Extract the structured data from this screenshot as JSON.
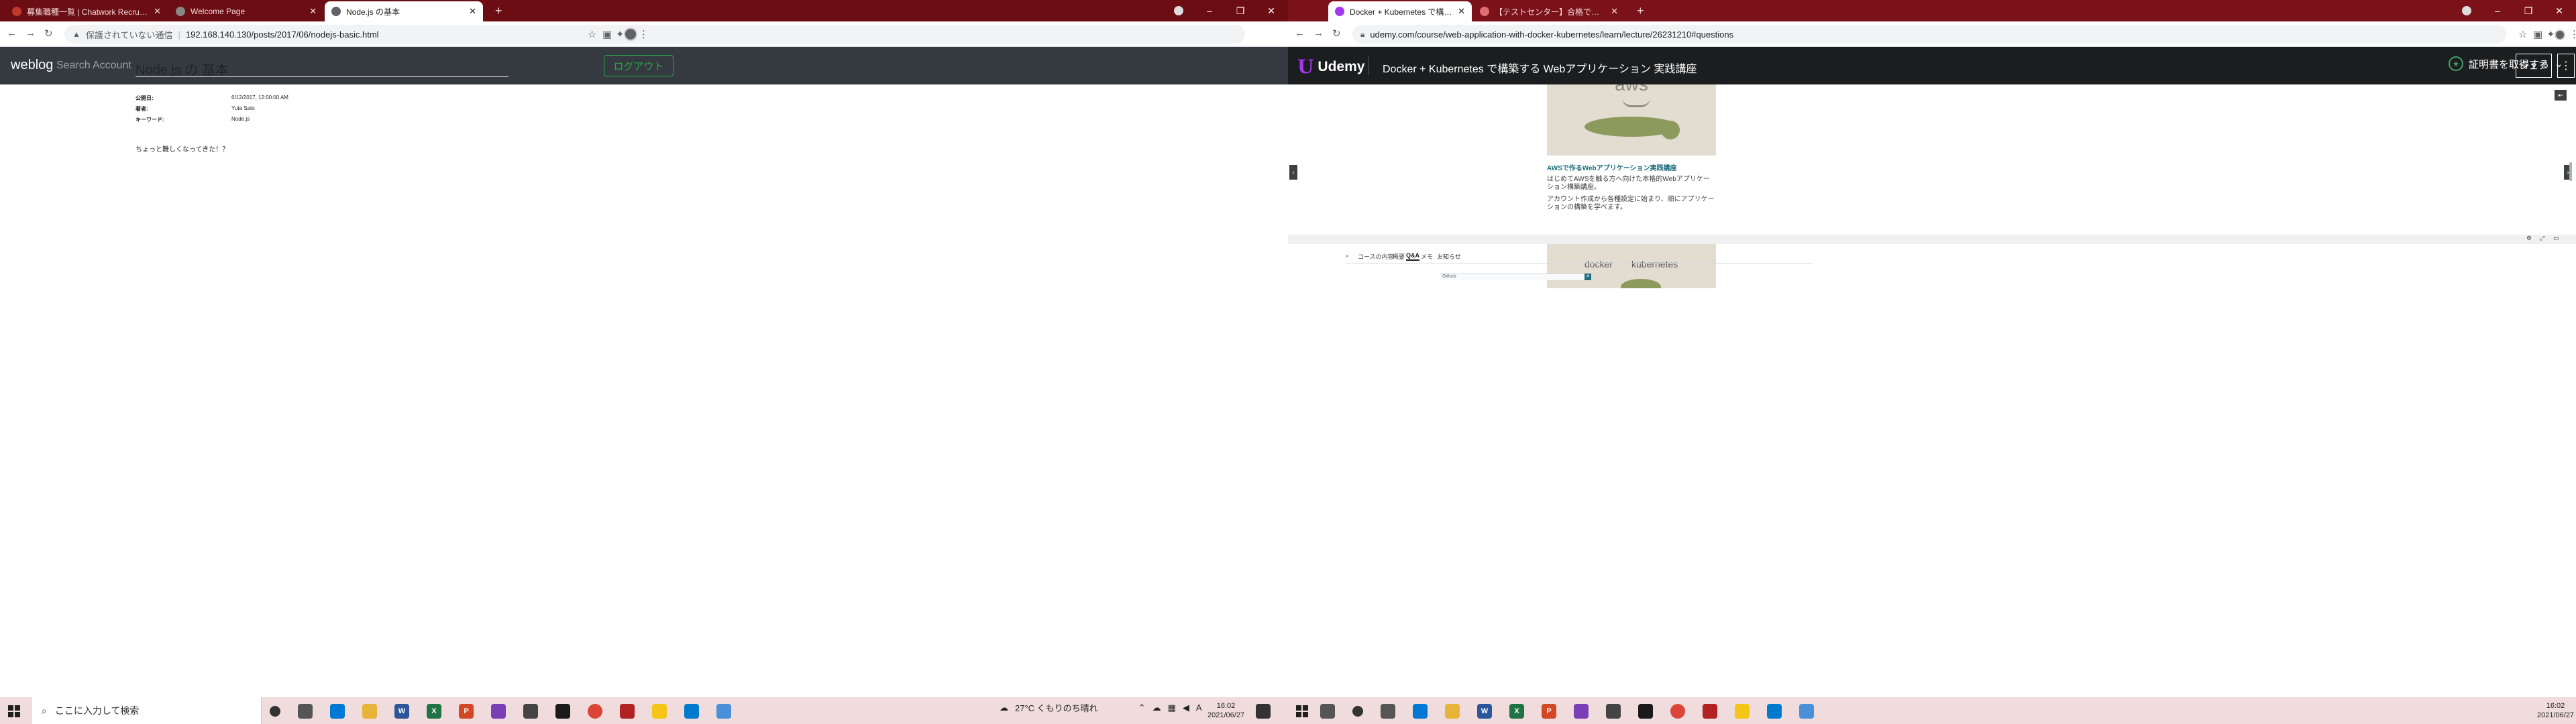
{
  "left_browser": {
    "tabs": [
      {
        "label": "募集職種一覧 | Chatwork Recruitin",
        "favicon_color": "#c0392b"
      },
      {
        "label": "Welcome Page",
        "favicon_color": "#888888"
      },
      {
        "label": "Node.js の基本",
        "favicon_color": "#5f6368"
      }
    ],
    "url": {
      "security_label": "保護されていない通信",
      "address": "192.168.140.130/posts/2017/06/nodejs-basic.html"
    }
  },
  "weblog": {
    "brand": "weblog",
    "nav": {
      "search": "Search",
      "account": "Account"
    },
    "logout_label": "ログアウト",
    "post": {
      "title": "Node.js の 基本",
      "meta": [
        {
          "label": "公開日:",
          "value": "6/12/2017, 12:00:00 AM"
        },
        {
          "label": "著者:",
          "value": "Yuta Sato"
        },
        {
          "label": "キーワード:",
          "value": "Node.js"
        }
      ],
      "body": "ちょっと難しくなってきた！？"
    }
  },
  "right_browser": {
    "tabs": [
      {
        "label": "Docker + Kubernetes で構築する",
        "favicon_color": "#a435f0"
      },
      {
        "label": "【テストセンター】合格での受検日が近",
        "favicon_color": "#e06c75"
      }
    ],
    "url": {
      "address": "udemy.com/course/web-application-with-docker-kubernetes/learn/lecture/26231210#questions"
    }
  },
  "udemy": {
    "logo_text": "Udemy",
    "course_title": "Docker + Kubernetes で構築する Webアプリケーション 実践講座",
    "certificate_label": "証明書を取得する",
    "share_label": "シェア",
    "lecture_cards": [
      {
        "image_text": "aws",
        "link": "AWSで作るWebアプリケーション実践講座",
        "desc1": "はじめてAWSを触る方へ向けた本格的Webアプリケーション構築講座。",
        "desc2": "アカウント作成から各種設定に始まり、順にアプリケーションの構築を学べます。"
      },
      {
        "image_text_left": "docker",
        "image_text_right": "kubernetes"
      }
    ],
    "tabs": [
      "コースの内容",
      "概要",
      "Q&A",
      "メモ",
      "お知らせ"
    ],
    "active_tab": "Q&A",
    "question_input_text": "Github"
  },
  "taskbar": {
    "search_placeholder": "ここに入力して検索",
    "weather": "27°C くもりのち晴れ",
    "ime": "A",
    "time": "16:02",
    "date": "2021/06/27"
  }
}
